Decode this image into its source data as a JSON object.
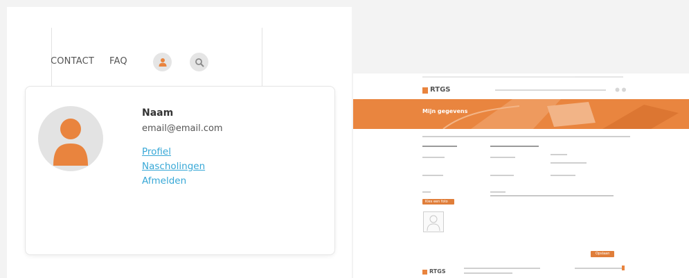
{
  "nav": {
    "contact_label": "CONTACT",
    "faq_label": "FAQ",
    "user_icon": "user-icon",
    "search_icon": "search-icon"
  },
  "account_menu": {
    "name": "Naam",
    "email": "email@email.com",
    "links": [
      {
        "label": "Profiel"
      },
      {
        "label": "Nascholingen"
      },
      {
        "label": "Afmelden"
      }
    ]
  },
  "thumbnail": {
    "logo_text": "RTGS",
    "banner_title": "Mijn gegevens",
    "save_button_label": "Opslaan",
    "upload_button_label": "Kies een foto",
    "footer_logo_text": "RTGS"
  },
  "colors": {
    "accent": "#e9843e",
    "link": "#36a7d6",
    "panel_bg": "#ffffff",
    "page_bg": "#f3f3f3"
  }
}
